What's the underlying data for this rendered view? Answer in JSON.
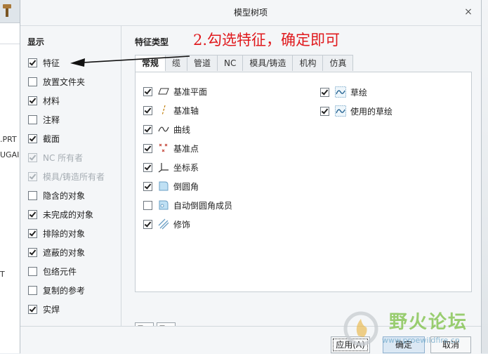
{
  "background": {
    "text_lines": [
      ".PRT",
      "UGAI",
      "T"
    ]
  },
  "dialog": {
    "title": "模型树项",
    "close_glyph": "×"
  },
  "left": {
    "section_label": "显示",
    "items": [
      {
        "label": "特征",
        "checked": true,
        "disabled": false
      },
      {
        "label": "放置文件夹",
        "checked": false,
        "disabled": false
      },
      {
        "label": "材料",
        "checked": true,
        "disabled": false
      },
      {
        "label": "注释",
        "checked": false,
        "disabled": false
      },
      {
        "label": "截面",
        "checked": true,
        "disabled": false
      },
      {
        "label": "NC 所有者",
        "checked": true,
        "disabled": true
      },
      {
        "label": "模具/铸造所有者",
        "checked": true,
        "disabled": true
      },
      {
        "label": "隐含的对象",
        "checked": false,
        "disabled": false
      },
      {
        "label": "未完成的对象",
        "checked": true,
        "disabled": false
      },
      {
        "label": "排除的对象",
        "checked": true,
        "disabled": false
      },
      {
        "label": "遮蔽的对象",
        "checked": true,
        "disabled": false
      },
      {
        "label": "包络元件",
        "checked": false,
        "disabled": false
      },
      {
        "label": "复制的参考",
        "checked": false,
        "disabled": false
      },
      {
        "label": "实焊",
        "checked": true,
        "disabled": false
      }
    ]
  },
  "right": {
    "section_label": "特征类型",
    "annotation": "2.勾选特征，确定即可",
    "tabs": [
      {
        "label": "常规",
        "active": true
      },
      {
        "label": "缆",
        "active": false
      },
      {
        "label": "管道",
        "active": false
      },
      {
        "label": "NC",
        "active": false
      },
      {
        "label": "模具/铸造",
        "active": false
      },
      {
        "label": "机构",
        "active": false
      },
      {
        "label": "仿真",
        "active": false
      }
    ],
    "features_col1": [
      {
        "label": "基准平面",
        "checked": true,
        "icon": "datum-plane-icon"
      },
      {
        "label": "基准轴",
        "checked": true,
        "icon": "datum-axis-icon"
      },
      {
        "label": "曲线",
        "checked": true,
        "icon": "curve-icon"
      },
      {
        "label": "基准点",
        "checked": true,
        "icon": "datum-point-icon"
      },
      {
        "label": "坐标系",
        "checked": true,
        "icon": "coordinate-system-icon"
      },
      {
        "label": "倒圆角",
        "checked": true,
        "icon": "round-icon"
      },
      {
        "label": "自动倒圆角成员",
        "checked": false,
        "icon": "auto-round-icon"
      },
      {
        "label": "修饰",
        "checked": true,
        "icon": "cosmetic-icon"
      }
    ],
    "features_col2": [
      {
        "label": "草绘",
        "checked": true,
        "icon": "sketch-icon"
      },
      {
        "label": "使用的草绘",
        "checked": true,
        "icon": "used-sketch-icon"
      }
    ]
  },
  "footer": {
    "apply": "应用(A)",
    "ok": "确定",
    "cancel": "取消"
  },
  "watermark": {
    "text": "野火论坛",
    "url": "www.proewildfire.cn"
  },
  "colors": {
    "annotation": "#e0191d",
    "accent": "#3a8fd8",
    "watermark": "#7bc043"
  }
}
